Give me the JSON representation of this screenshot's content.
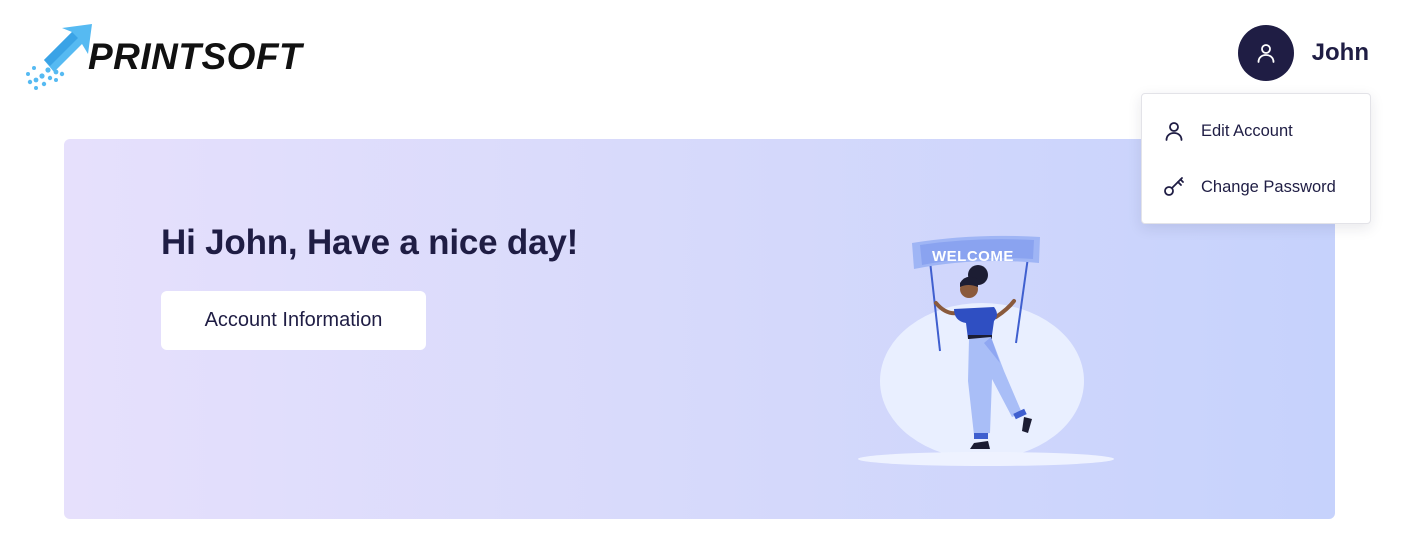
{
  "brand": {
    "name": "PRINTSOFT",
    "logo_icon": "rocket-arrow-icon",
    "accent": "#4db3f0"
  },
  "user": {
    "name": "John",
    "avatar_icon": "user-icon",
    "avatar_color": "#1f1d44"
  },
  "dropdown": {
    "items": [
      {
        "label": "Edit Account",
        "icon": "user-icon"
      },
      {
        "label": "Change Password",
        "icon": "key-icon"
      }
    ]
  },
  "banner": {
    "greeting": "Hi John, Have a nice day!",
    "button_label": "Account Information",
    "illustration_text": "WELCOME",
    "gradient": [
      "#e6e0fc",
      "#c6d2fc"
    ]
  }
}
